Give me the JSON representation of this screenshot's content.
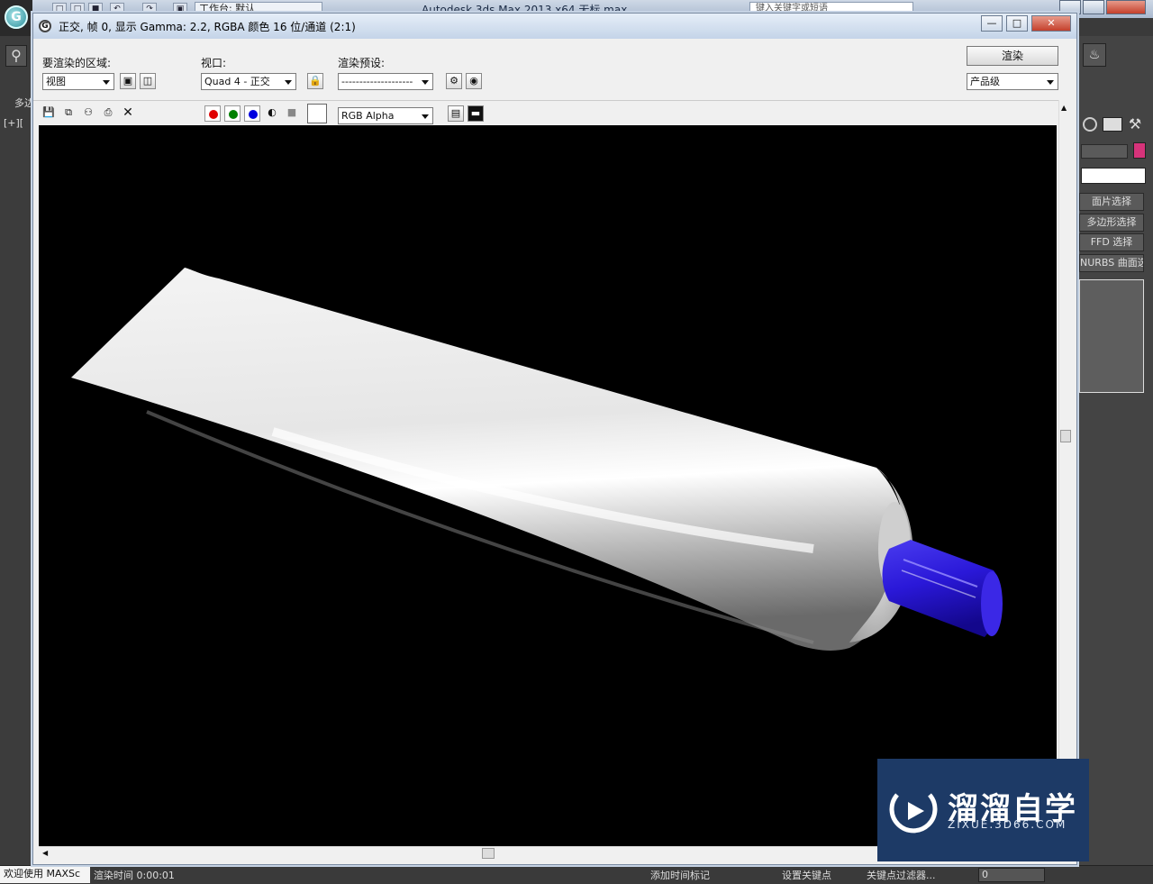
{
  "app": {
    "title": "Autodesk 3ds Max  2013 x64      无标 max",
    "workspace": "工作台: 默认",
    "search_placeholder": "键入关键字或短语",
    "quick_access": [
      "□",
      "□",
      "■",
      "↶",
      "↷",
      "▣"
    ],
    "left_viewport_label": "[+][",
    "left_tab_label": "多边",
    "right_panel": {
      "buttons": [
        "面片选择",
        "多边形选择",
        "FFD 选择",
        "NURBS 曲面选择"
      ],
      "accent_color": "#d6337a"
    }
  },
  "render_window": {
    "title": "正交, 帧 0, 显示 Gamma: 2.2, RGBA 颜色 16 位/通道 (2:1)",
    "area_label": "要渲染的区域:",
    "area_value": "视图",
    "viewport_label": "视口:",
    "viewport_value": "Quad 4 - 正交",
    "preset_label": "渲染预设:",
    "preset_value": "--------------------",
    "render_button": "渲染",
    "quality_value": "产品级",
    "channel_value": "RGB Alpha",
    "channels": [
      {
        "name": "red",
        "color": "#e00000"
      },
      {
        "name": "green",
        "color": "#008000"
      },
      {
        "name": "blue",
        "color": "#0000e0"
      }
    ],
    "close_glyph": "✕",
    "min_glyph": "—",
    "max_glyph": "□"
  },
  "scene": {
    "background": "#000000",
    "tube_color": "#eeeeee",
    "cap_color": "#2a18d8"
  },
  "status_bar": {
    "welcome": "欢迎使用 MAXSc",
    "render_time": "渲染时间  0:00:01",
    "add_time_tag": "添加时间标记",
    "set_key": "设置关键点",
    "key_filter": "关键点过滤器...",
    "frame_value": "0"
  },
  "watermark": {
    "title": "溜溜自学",
    "subtitle": "ZIXUE.3D66.COM"
  }
}
